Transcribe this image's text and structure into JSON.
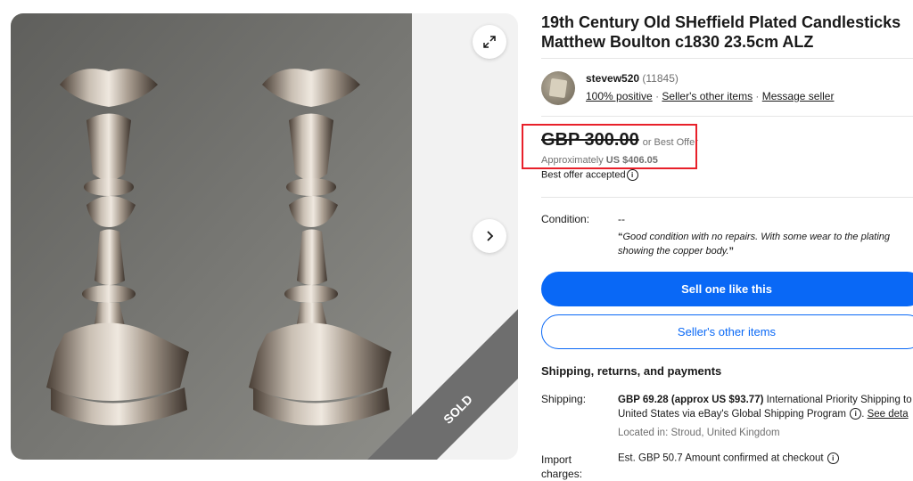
{
  "listing": {
    "title": "19th Century Old SHeffield Plated Candlesticks Matthew Boulton c1830 23.5cm ALZ",
    "sold_label": "SOLD"
  },
  "seller": {
    "name": "stevew520",
    "score": "(11845)",
    "positive": "100% positive",
    "sep": "·",
    "other_items": "Seller's other items",
    "message": "Message seller"
  },
  "price": {
    "amount": "GBP 300.00",
    "best_offer": "or Best Offer",
    "approx_label": "Approximately",
    "approx_value": "US $406.05",
    "accepted": "Best offer accepted",
    "info_glyph": "i"
  },
  "condition": {
    "label": "Condition:",
    "value": "--",
    "quote_open": "“",
    "quote_line1": "Good condition with no repairs. With some wear to the plating",
    "quote_line2": "showing the copper body.",
    "quote_close": "”"
  },
  "buttons": {
    "sell": "Sell one like this",
    "other_items": "Seller's other items"
  },
  "shipping": {
    "section_title": "Shipping, returns, and payments",
    "label": "Shipping:",
    "price": "GBP 69.28 (approx US $93.77)",
    "text1": " International Priority Shipping to",
    "text2": "United States via eBay's Global Shipping Program",
    "see_details": "See deta",
    "location": "Located in: Stroud, United Kingdom",
    "import_label_1": "Import",
    "import_label_2": "charges:",
    "import_amount": "Est. GBP 50.7",
    "import_note": " Amount confirmed at checkout"
  },
  "colors": {
    "accent_blue": "#0968f6",
    "highlight_red": "#e8202a",
    "sold_ribbon": "#6e6e6e"
  },
  "icons": [
    "expand-icon",
    "chevron-right-icon",
    "info-icon"
  ]
}
